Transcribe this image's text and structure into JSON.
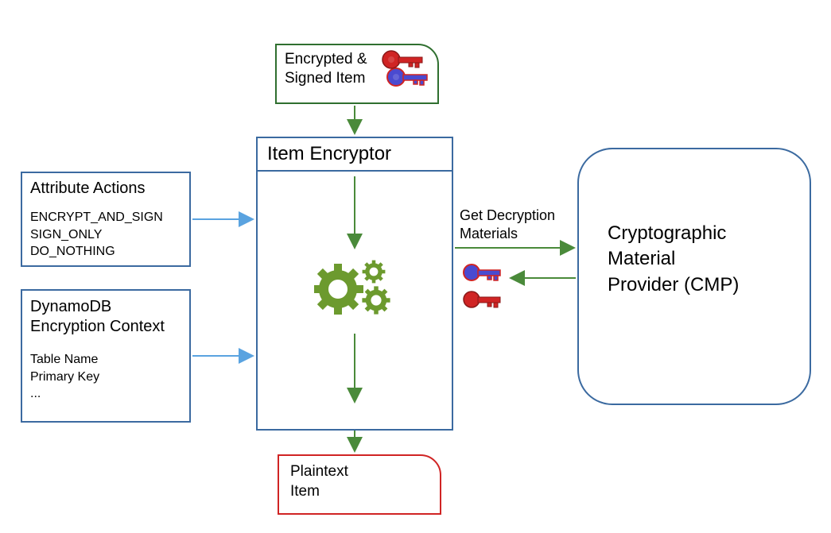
{
  "encrypted_signed": {
    "line1": "Encrypted &",
    "line2": "Signed Item"
  },
  "encryptor": {
    "title": "Item Encryptor"
  },
  "attribute_actions": {
    "title": "Attribute Actions",
    "items": [
      "ENCRYPT_AND_SIGN",
      "SIGN_ONLY",
      "DO_NOTHING"
    ]
  },
  "encryption_context": {
    "title_line1": "DynamoDB",
    "title_line2": "Encryption Context",
    "items": [
      "Table Name",
      "Primary Key",
      "..."
    ]
  },
  "cmp": {
    "line1": "Cryptographic",
    "line2": "Material",
    "line3": "Provider (CMP)"
  },
  "get_materials": {
    "line1": "Get Decryption",
    "line2": "Materials"
  },
  "plaintext": {
    "line1": "Plaintext",
    "line2": "Item"
  },
  "colors": {
    "blue_border": "#3b6aa0",
    "green_border": "#2f6f2f",
    "red_border": "#d02424",
    "arrow_blue": "#5aa3e0",
    "arrow_green": "#4a8a3a",
    "gear": "#6c9a2e",
    "key_red": "#d02424",
    "key_blue": "#4a4ad0"
  }
}
